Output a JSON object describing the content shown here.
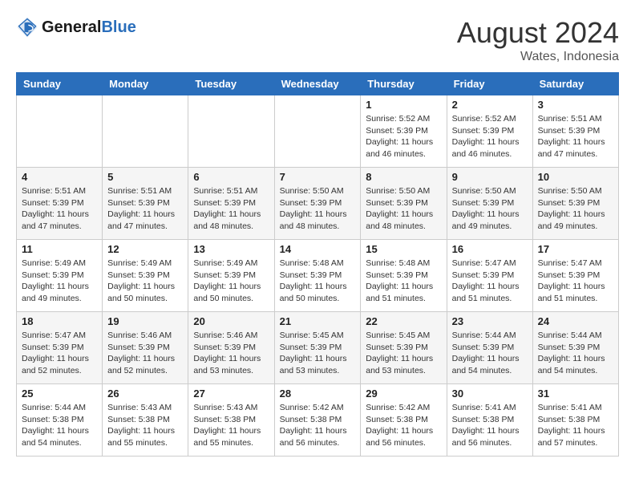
{
  "header": {
    "logo_line1": "General",
    "logo_line2": "Blue",
    "month_year": "August 2024",
    "location": "Wates, Indonesia"
  },
  "weekdays": [
    "Sunday",
    "Monday",
    "Tuesday",
    "Wednesday",
    "Thursday",
    "Friday",
    "Saturday"
  ],
  "weeks": [
    [
      {
        "day": "",
        "info": ""
      },
      {
        "day": "",
        "info": ""
      },
      {
        "day": "",
        "info": ""
      },
      {
        "day": "",
        "info": ""
      },
      {
        "day": "1",
        "info": "Sunrise: 5:52 AM\nSunset: 5:39 PM\nDaylight: 11 hours\nand 46 minutes."
      },
      {
        "day": "2",
        "info": "Sunrise: 5:52 AM\nSunset: 5:39 PM\nDaylight: 11 hours\nand 46 minutes."
      },
      {
        "day": "3",
        "info": "Sunrise: 5:51 AM\nSunset: 5:39 PM\nDaylight: 11 hours\nand 47 minutes."
      }
    ],
    [
      {
        "day": "4",
        "info": "Sunrise: 5:51 AM\nSunset: 5:39 PM\nDaylight: 11 hours\nand 47 minutes."
      },
      {
        "day": "5",
        "info": "Sunrise: 5:51 AM\nSunset: 5:39 PM\nDaylight: 11 hours\nand 47 minutes."
      },
      {
        "day": "6",
        "info": "Sunrise: 5:51 AM\nSunset: 5:39 PM\nDaylight: 11 hours\nand 48 minutes."
      },
      {
        "day": "7",
        "info": "Sunrise: 5:50 AM\nSunset: 5:39 PM\nDaylight: 11 hours\nand 48 minutes."
      },
      {
        "day": "8",
        "info": "Sunrise: 5:50 AM\nSunset: 5:39 PM\nDaylight: 11 hours\nand 48 minutes."
      },
      {
        "day": "9",
        "info": "Sunrise: 5:50 AM\nSunset: 5:39 PM\nDaylight: 11 hours\nand 49 minutes."
      },
      {
        "day": "10",
        "info": "Sunrise: 5:50 AM\nSunset: 5:39 PM\nDaylight: 11 hours\nand 49 minutes."
      }
    ],
    [
      {
        "day": "11",
        "info": "Sunrise: 5:49 AM\nSunset: 5:39 PM\nDaylight: 11 hours\nand 49 minutes."
      },
      {
        "day": "12",
        "info": "Sunrise: 5:49 AM\nSunset: 5:39 PM\nDaylight: 11 hours\nand 50 minutes."
      },
      {
        "day": "13",
        "info": "Sunrise: 5:49 AM\nSunset: 5:39 PM\nDaylight: 11 hours\nand 50 minutes."
      },
      {
        "day": "14",
        "info": "Sunrise: 5:48 AM\nSunset: 5:39 PM\nDaylight: 11 hours\nand 50 minutes."
      },
      {
        "day": "15",
        "info": "Sunrise: 5:48 AM\nSunset: 5:39 PM\nDaylight: 11 hours\nand 51 minutes."
      },
      {
        "day": "16",
        "info": "Sunrise: 5:47 AM\nSunset: 5:39 PM\nDaylight: 11 hours\nand 51 minutes."
      },
      {
        "day": "17",
        "info": "Sunrise: 5:47 AM\nSunset: 5:39 PM\nDaylight: 11 hours\nand 51 minutes."
      }
    ],
    [
      {
        "day": "18",
        "info": "Sunrise: 5:47 AM\nSunset: 5:39 PM\nDaylight: 11 hours\nand 52 minutes."
      },
      {
        "day": "19",
        "info": "Sunrise: 5:46 AM\nSunset: 5:39 PM\nDaylight: 11 hours\nand 52 minutes."
      },
      {
        "day": "20",
        "info": "Sunrise: 5:46 AM\nSunset: 5:39 PM\nDaylight: 11 hours\nand 53 minutes."
      },
      {
        "day": "21",
        "info": "Sunrise: 5:45 AM\nSunset: 5:39 PM\nDaylight: 11 hours\nand 53 minutes."
      },
      {
        "day": "22",
        "info": "Sunrise: 5:45 AM\nSunset: 5:39 PM\nDaylight: 11 hours\nand 53 minutes."
      },
      {
        "day": "23",
        "info": "Sunrise: 5:44 AM\nSunset: 5:39 PM\nDaylight: 11 hours\nand 54 minutes."
      },
      {
        "day": "24",
        "info": "Sunrise: 5:44 AM\nSunset: 5:39 PM\nDaylight: 11 hours\nand 54 minutes."
      }
    ],
    [
      {
        "day": "25",
        "info": "Sunrise: 5:44 AM\nSunset: 5:38 PM\nDaylight: 11 hours\nand 54 minutes."
      },
      {
        "day": "26",
        "info": "Sunrise: 5:43 AM\nSunset: 5:38 PM\nDaylight: 11 hours\nand 55 minutes."
      },
      {
        "day": "27",
        "info": "Sunrise: 5:43 AM\nSunset: 5:38 PM\nDaylight: 11 hours\nand 55 minutes."
      },
      {
        "day": "28",
        "info": "Sunrise: 5:42 AM\nSunset: 5:38 PM\nDaylight: 11 hours\nand 56 minutes."
      },
      {
        "day": "29",
        "info": "Sunrise: 5:42 AM\nSunset: 5:38 PM\nDaylight: 11 hours\nand 56 minutes."
      },
      {
        "day": "30",
        "info": "Sunrise: 5:41 AM\nSunset: 5:38 PM\nDaylight: 11 hours\nand 56 minutes."
      },
      {
        "day": "31",
        "info": "Sunrise: 5:41 AM\nSunset: 5:38 PM\nDaylight: 11 hours\nand 57 minutes."
      }
    ]
  ]
}
